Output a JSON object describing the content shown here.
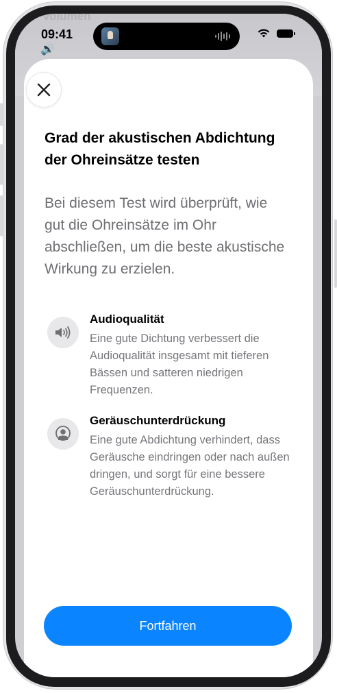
{
  "background": {
    "label": "Volumen"
  },
  "status_bar": {
    "time": "09:41",
    "speaker_glyph": "🔊"
  },
  "icons": {
    "close": "close-icon",
    "speaker": "speaker-icon",
    "noise": "person-icon",
    "wifi": "wifi-icon",
    "battery": "battery-icon",
    "waveform": "waveform-icon"
  },
  "sheet": {
    "title": "Grad der akustischen Abdichtung der Ohreinsätze testen",
    "subtitle": "Bei diesem Test wird überprüft, wie gut die Ohreinsätze im Ohr abschließen, um die beste akustische Wirkung zu erzielen.",
    "features": [
      {
        "title": "Audioqualität",
        "description": "Eine gute Dichtung verbessert die Audioqualität insgesamt mit tieferen Bässen und satteren niedrigen Frequenzen."
      },
      {
        "title": "Geräuschunterdrückung",
        "description": "Eine gute Abdichtung verhindert, dass Geräusche eindringen oder nach außen dringen, und sorgt für eine bessere Geräuschunterdrückung."
      }
    ],
    "continue_label": "Fortfahren"
  },
  "colors": {
    "accent": "#0a84ff",
    "secondary_text": "#6e6e73"
  }
}
